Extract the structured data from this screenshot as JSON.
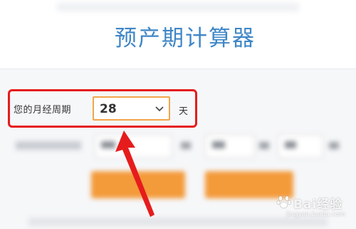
{
  "header": {
    "title": "预产期计算器"
  },
  "form": {
    "cycle_label": "您的月经周期",
    "cycle_value": "28",
    "cycle_unit": "天"
  },
  "icons": {
    "dropdown": "chevron-down-icon",
    "annotation": "red-arrow-icon",
    "watermark": "baidu-jingyan-logo"
  },
  "colors": {
    "title": "#3f86c6",
    "highlight_border": "#e61c1c",
    "select_border": "#f3a54a",
    "button": "#f39a3a"
  },
  "watermark": {
    "text": "Bai经验",
    "url": "jingyan.baidu.com"
  }
}
